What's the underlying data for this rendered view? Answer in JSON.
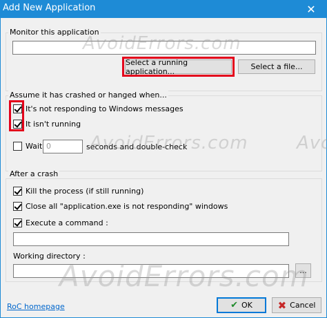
{
  "window": {
    "title": "Add New Application",
    "close_glyph": "✕"
  },
  "monitor": {
    "group_label": "Monitor this application",
    "path_value": "",
    "select_running_label": "Select a running application...",
    "select_file_label": "Select a file..."
  },
  "crash_detect": {
    "group_label": "Assume it has crashed or hanged when...",
    "not_responding_label": "It's not responding to Windows messages",
    "not_running_label": "It isn't running",
    "wait_label": "Wait",
    "wait_value": "0",
    "wait_suffix": "seconds and double-check"
  },
  "after_crash": {
    "group_label": "After a crash",
    "kill_label": "Kill the process (if still running)",
    "close_all_label": "Close all \"application.exe is not responding\" windows",
    "execute_label": "Execute a command :",
    "command_value": "",
    "working_dir_label": "Working directory :",
    "working_dir_value": "",
    "browse_label": "..."
  },
  "footer": {
    "homepage_link": "RoC homepage",
    "ok_label": "OK",
    "cancel_label": "Cancel"
  },
  "watermark": {
    "text": "AvoidErrors.com"
  },
  "icons": {
    "ok": "check-icon",
    "cancel": "cross-icon",
    "close": "close-icon"
  },
  "colors": {
    "titlebar": "#1e8bd6",
    "highlight": "#e3001b",
    "link": "#0066cc"
  }
}
